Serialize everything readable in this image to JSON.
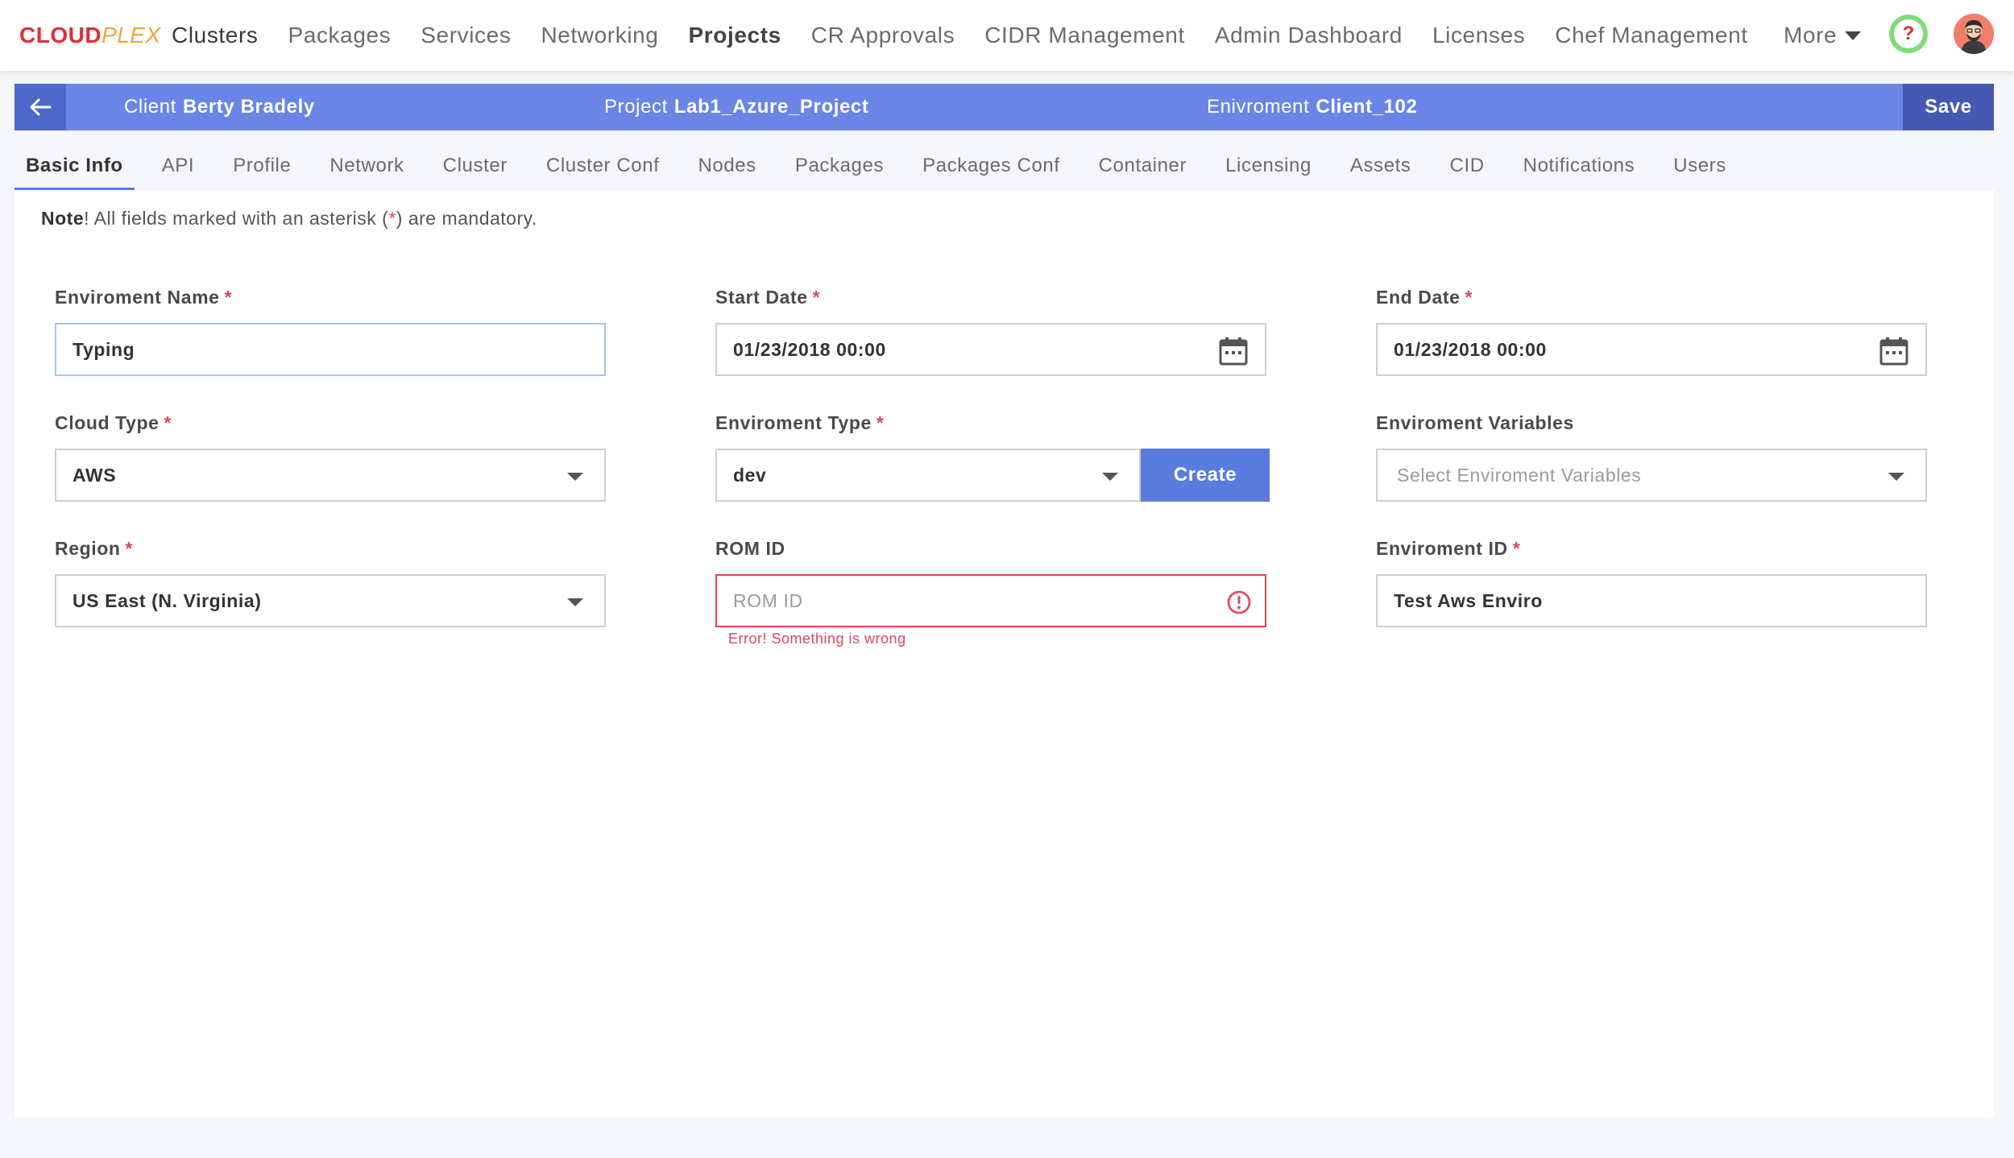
{
  "brand": {
    "part1": "CLOUD",
    "part2": "PLEX"
  },
  "nav": {
    "items": [
      {
        "label": "Clusters"
      },
      {
        "label": "Packages"
      },
      {
        "label": "Services"
      },
      {
        "label": "Networking"
      },
      {
        "label": "Projects"
      },
      {
        "label": "CR Approvals"
      },
      {
        "label": "CIDR Management"
      },
      {
        "label": "Admin Dashboard"
      },
      {
        "label": "Licenses"
      },
      {
        "label": "Chef Management"
      }
    ],
    "more_label": "More",
    "help_glyph": "?"
  },
  "context": {
    "client_label": "Client",
    "client_value": "Berty Bradely",
    "project_label": "Project",
    "project_value": "Lab1_Azure_Project",
    "env_label": "Enivroment",
    "env_value": "Client_102",
    "save_label": "Save"
  },
  "tabs": [
    {
      "label": "Basic Info"
    },
    {
      "label": "API"
    },
    {
      "label": "Profile"
    },
    {
      "label": "Network"
    },
    {
      "label": "Cluster"
    },
    {
      "label": "Cluster Conf"
    },
    {
      "label": "Nodes"
    },
    {
      "label": "Packages"
    },
    {
      "label": "Packages Conf"
    },
    {
      "label": "Container"
    },
    {
      "label": "Licensing"
    },
    {
      "label": "Assets"
    },
    {
      "label": "CID"
    },
    {
      "label": "Notifications"
    },
    {
      "label": "Users"
    }
  ],
  "note": {
    "prefix": "Note",
    "text1": "! All fields marked with an asterisk (",
    "asterisk": "*",
    "text2": ") are mandatory."
  },
  "form": {
    "env_name": {
      "label": "Enviroment Name",
      "value": "Typing"
    },
    "start_date": {
      "label": "Start Date",
      "value": "01/23/2018 00:00"
    },
    "end_date": {
      "label": "End Date",
      "value": "01/23/2018 00:00"
    },
    "cloud_type": {
      "label": "Cloud Type",
      "value": "AWS"
    },
    "env_type": {
      "label": "Enviroment Type",
      "value": "dev",
      "create_label": "Create"
    },
    "env_vars": {
      "label": "Enviroment Variables",
      "placeholder": "Select Enviroment Variables"
    },
    "region": {
      "label": "Region",
      "value": "US East (N. Virginia)"
    },
    "rom_id": {
      "label": "ROM ID",
      "placeholder": "ROM ID",
      "error": "Error! Something is wrong"
    },
    "env_id": {
      "label": "Enviroment ID",
      "value": "Test Aws Enviro"
    },
    "required_mark": "*"
  },
  "colors": {
    "accent": "#5a7be0",
    "context_bar": "#6a85e6",
    "error": "#e0455a",
    "brand_red": "#e02d3c",
    "brand_orange": "#f2a33a"
  }
}
